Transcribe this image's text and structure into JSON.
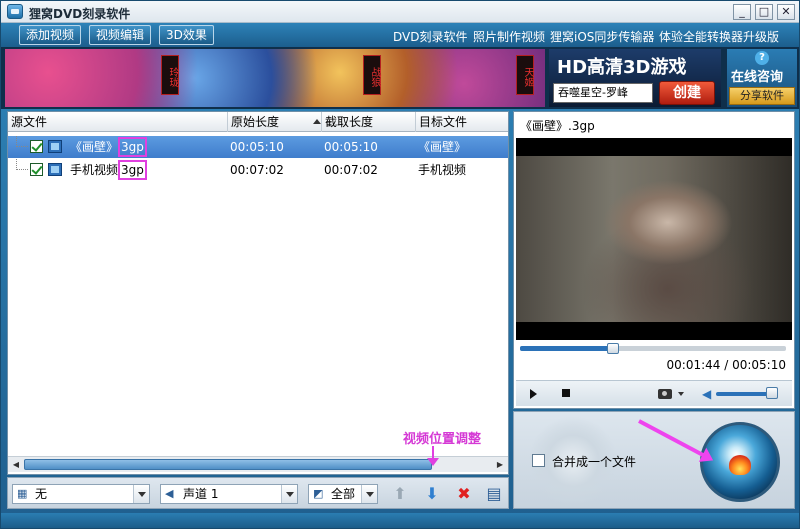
{
  "window": {
    "title": "狸窝DVD刻录软件",
    "min": "_",
    "max": "□",
    "close": "✕"
  },
  "toolbar": {
    "buttons": [
      "添加视频",
      "视频编辑",
      "3D效果"
    ],
    "links": [
      "DVD刻录软件",
      "照片制作视频",
      "狸窝iOS同步传输器",
      "体验全能转换器升级版"
    ]
  },
  "banner": {
    "tags": [
      "玲珑",
      "战狼",
      "天姬"
    ],
    "hd_title": "HD高清3D游戏",
    "hd_sub": "吞噬星空-罗峰",
    "hd_create": "创建",
    "consult_q": "?",
    "consult": "在线咨询",
    "share": "分享软件"
  },
  "list": {
    "headers": [
      "源文件",
      "原始长度",
      "截取长度",
      "目标文件"
    ],
    "rows": [
      {
        "name": "《画壁》",
        "ext": "3gp",
        "orig": "00:05:10",
        "cut": "00:05:10",
        "target": "《画壁》",
        "selected": true
      },
      {
        "name": "手机视频",
        "ext": "3gp",
        "orig": "00:07:02",
        "cut": "00:07:02",
        "target": "手机视频",
        "selected": false
      }
    ]
  },
  "annotation": "视频位置调整",
  "controls": {
    "subtitle": "无",
    "audio": "声道 1",
    "scope": "全部",
    "up": "⬆",
    "down": "⬇",
    "delete": "✖",
    "clear": "▤"
  },
  "preview": {
    "title": "《画壁》.3gp",
    "time": "00:01:44 / 00:05:10",
    "progress": 0.35,
    "volume": 0.85
  },
  "burn": {
    "merge_label": "合并成一个文件"
  }
}
